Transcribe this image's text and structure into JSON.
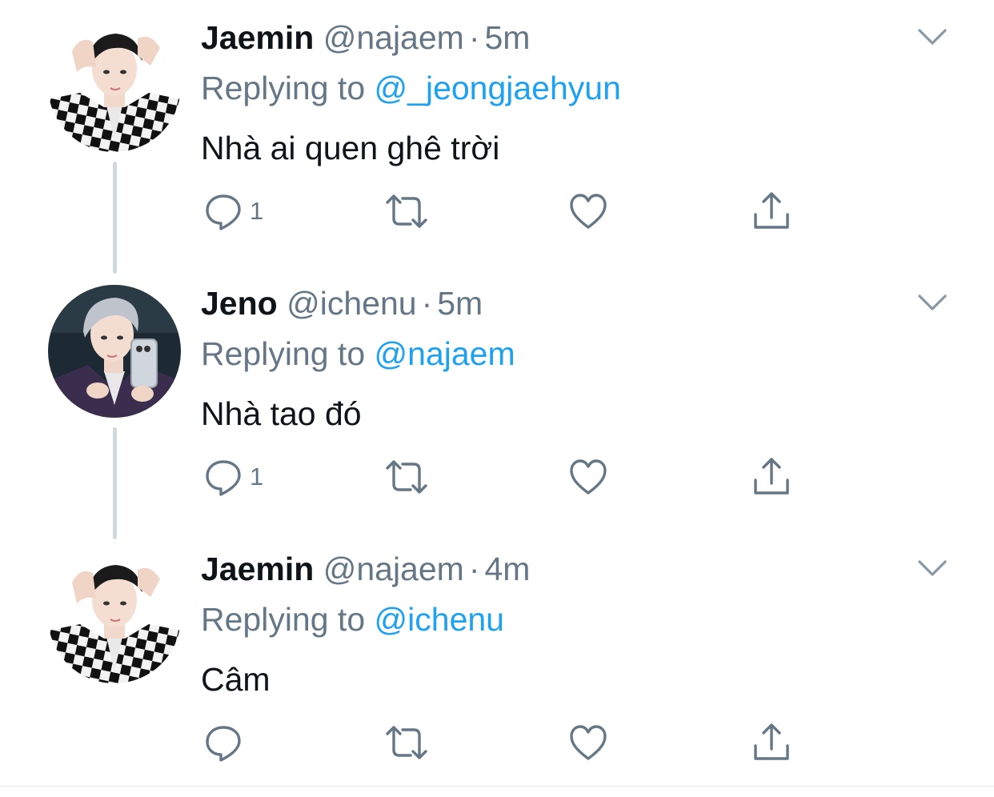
{
  "tweets": [
    {
      "name": "Jaemin",
      "handle": "@najaem",
      "separator": "·",
      "time": "5m",
      "reply_prefix": "Replying to",
      "reply_to": "@_jeongjaehyun",
      "text": "Nhà ai quen ghê trời",
      "reply_count": "1",
      "avatar_icon": "avatar-checkered-jacket",
      "has_thread_line": true
    },
    {
      "name": "Jeno",
      "handle": "@ichenu",
      "separator": "·",
      "time": "5m",
      "reply_prefix": "Replying to",
      "reply_to": "@najaem",
      "text": "Nhà tao đó",
      "reply_count": "1",
      "avatar_icon": "avatar-mirror-selfie",
      "has_thread_line": true
    },
    {
      "name": "Jaemin",
      "handle": "@najaem",
      "separator": "·",
      "time": "4m",
      "reply_prefix": "Replying to",
      "reply_to": "@ichenu",
      "text": "Câm",
      "reply_count": "",
      "avatar_icon": "avatar-checkered-jacket",
      "has_thread_line": false
    }
  ],
  "colors": {
    "name": "#0f1419",
    "secondary": "#657786",
    "mention": "#1da1f2",
    "icon": "#657786",
    "thread_line": "#cfd9de"
  }
}
